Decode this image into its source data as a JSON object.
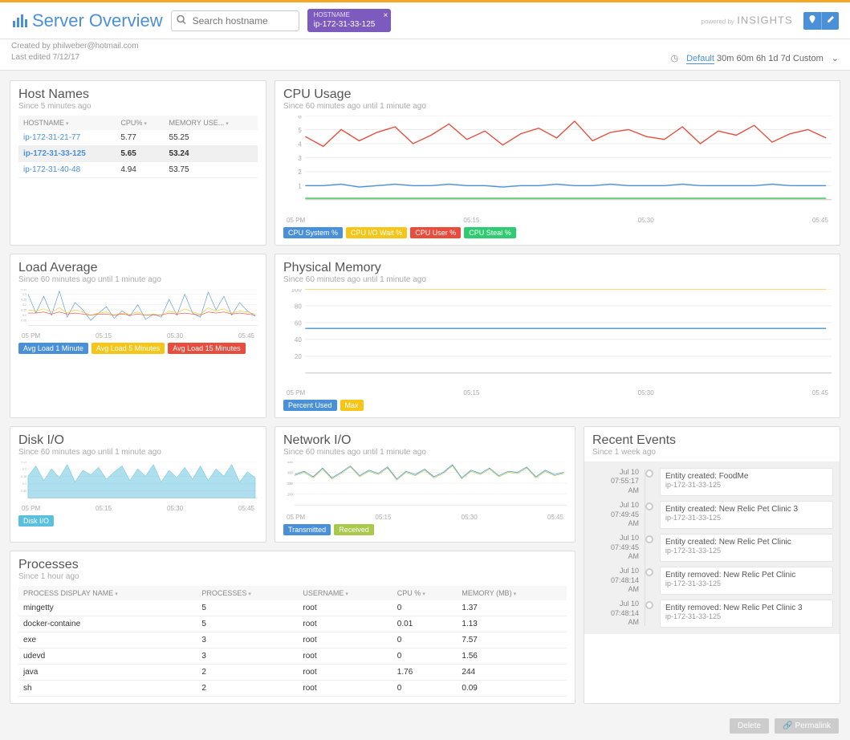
{
  "header": {
    "title": "Server Overview",
    "search_placeholder": "Search hostname",
    "chip_label": "HOSTNAME",
    "chip_value": "ip-172-31-33-125",
    "brand_powered": "powered by",
    "brand_name": "INSIGHTS"
  },
  "meta": {
    "created": "Created by philweber@hotmail.com",
    "edited": "Last edited 7/12/17"
  },
  "time_picker": {
    "options": [
      "Default",
      "30m",
      "60m",
      "6h",
      "1d",
      "7d",
      "Custom"
    ],
    "active": "Default"
  },
  "host_names": {
    "title": "Host Names",
    "subtitle": "Since 5 minutes ago",
    "columns": [
      "HOSTNAME",
      "CPU%",
      "MEMORY USE..."
    ],
    "rows": [
      {
        "host": "ip-172-31-21-77",
        "cpu": "5.77",
        "mem": "55.25",
        "selected": false
      },
      {
        "host": "ip-172-31-33-125",
        "cpu": "5.65",
        "mem": "53.24",
        "selected": true
      },
      {
        "host": "ip-172-31-40-48",
        "cpu": "4.94",
        "mem": "53.75",
        "selected": false
      }
    ]
  },
  "chart_data": [
    {
      "id": "cpu_usage",
      "title": "CPU Usage",
      "subtitle": "Since 60 minutes ago until 1 minute ago",
      "type": "line",
      "xticks": [
        "05 PM",
        "05:15",
        "05:30",
        "05:45"
      ],
      "ylim": [
        0,
        6
      ],
      "yticks": [
        1,
        2,
        3,
        4,
        5,
        6
      ],
      "series": [
        {
          "name": "CPU System %",
          "color": "#4a90d9",
          "values": [
            1.0,
            1.0,
            1.1,
            0.9,
            1.0,
            1.1,
            1.0,
            1.0,
            1.1,
            1.0,
            1.0,
            0.9,
            1.0,
            1.0,
            1.1,
            1.0,
            1.0,
            1.1,
            1.0,
            1.0,
            1.0,
            1.1,
            1.0,
            1.0,
            1.0,
            1.0,
            1.1,
            1.0,
            1.0,
            1.0
          ]
        },
        {
          "name": "CPU I/O Wait %",
          "color": "#f5c518",
          "values": [
            0.1,
            0.1,
            0.1,
            0.1,
            0.1,
            0.1,
            0.1,
            0.1,
            0.1,
            0.1,
            0.1,
            0.1,
            0.1,
            0.1,
            0.1,
            0.1,
            0.1,
            0.1,
            0.1,
            0.1,
            0.1,
            0.1,
            0.1,
            0.1,
            0.1,
            0.1,
            0.1,
            0.1,
            0.1,
            0.1
          ]
        },
        {
          "name": "CPU User %",
          "color": "#e74c3c",
          "values": [
            4.5,
            3.8,
            5.0,
            4.2,
            4.8,
            5.2,
            4.0,
            4.6,
            5.4,
            4.3,
            4.9,
            3.9,
            4.7,
            5.1,
            4.4,
            5.6,
            4.2,
            4.8,
            5.0,
            4.5,
            4.3,
            5.2,
            4.0,
            4.9,
            4.6,
            5.3,
            4.1,
            4.7,
            5.0,
            4.4
          ]
        },
        {
          "name": "CPU Steal %",
          "color": "#2ecc71",
          "values": [
            0.1,
            0.1,
            0.1,
            0.1,
            0.1,
            0.1,
            0.1,
            0.1,
            0.1,
            0.1,
            0.1,
            0.1,
            0.1,
            0.1,
            0.1,
            0.1,
            0.1,
            0.1,
            0.1,
            0.1,
            0.1,
            0.1,
            0.1,
            0.1,
            0.1,
            0.1,
            0.1,
            0.1,
            0.1,
            0.1
          ]
        }
      ]
    },
    {
      "id": "load_avg",
      "title": "Load Average",
      "subtitle": "Since 60 minutes ago until 1 minute ago",
      "type": "line",
      "xticks": [
        "05 PM",
        "05:15",
        "05:30",
        "05:45"
      ],
      "ylim": [
        0,
        0.35
      ],
      "yticks": [
        0.05,
        0.1,
        0.15,
        0.2,
        0.25,
        0.3,
        0.35
      ],
      "series": [
        {
          "name": "Avg Load 1 Minute",
          "color": "#4a90d9",
          "values": [
            0.3,
            0.12,
            0.28,
            0.1,
            0.33,
            0.08,
            0.22,
            0.15,
            0.05,
            0.12,
            0.18,
            0.07,
            0.14,
            0.09,
            0.2,
            0.06,
            0.11,
            0.08,
            0.25,
            0.1,
            0.3,
            0.12,
            0.08,
            0.32,
            0.15,
            0.28,
            0.1,
            0.22,
            0.14,
            0.09
          ]
        },
        {
          "name": "Avg Load 5 Minutes",
          "color": "#f5c518",
          "values": [
            0.15,
            0.14,
            0.16,
            0.13,
            0.17,
            0.12,
            0.15,
            0.13,
            0.1,
            0.12,
            0.13,
            0.1,
            0.12,
            0.11,
            0.13,
            0.1,
            0.11,
            0.1,
            0.14,
            0.12,
            0.16,
            0.13,
            0.11,
            0.17,
            0.14,
            0.16,
            0.12,
            0.14,
            0.13,
            0.11
          ]
        },
        {
          "name": "Avg Load 15 Minutes",
          "color": "#e74c3c",
          "values": [
            0.12,
            0.12,
            0.13,
            0.11,
            0.13,
            0.11,
            0.12,
            0.11,
            0.1,
            0.11,
            0.11,
            0.1,
            0.11,
            0.1,
            0.11,
            0.1,
            0.1,
            0.1,
            0.12,
            0.11,
            0.12,
            0.11,
            0.1,
            0.13,
            0.12,
            0.13,
            0.11,
            0.12,
            0.11,
            0.1
          ]
        }
      ]
    },
    {
      "id": "phys_mem",
      "title": "Physical Memory",
      "subtitle": "Since 60 minutes ago until 1 minute ago",
      "type": "line",
      "xticks": [
        "05 PM",
        "05:15",
        "05:30",
        "05:45"
      ],
      "ylim": [
        0,
        100
      ],
      "yticks": [
        20,
        40,
        60,
        80,
        100
      ],
      "series": [
        {
          "name": "Percent Used",
          "color": "#4a90d9",
          "values": [
            53,
            53,
            53,
            53,
            53,
            53,
            53,
            53,
            53,
            53,
            53,
            53,
            53,
            53,
            53,
            53,
            53,
            53,
            53,
            53,
            53,
            53,
            53,
            53,
            53,
            53,
            53,
            53,
            53,
            53
          ]
        },
        {
          "name": "Max",
          "color": "#f5c518",
          "values": [
            100,
            100,
            100,
            100,
            100,
            100,
            100,
            100,
            100,
            100,
            100,
            100,
            100,
            100,
            100,
            100,
            100,
            100,
            100,
            100,
            100,
            100,
            100,
            100,
            100,
            100,
            100,
            100,
            100,
            100
          ]
        }
      ]
    },
    {
      "id": "disk_io",
      "title": "Disk I/O",
      "subtitle": "Since 60 minutes ago until 1 minute ago",
      "type": "area",
      "xticks": [
        "05 PM",
        "05:15",
        "05:30",
        "05:45"
      ],
      "ylim": [
        0,
        0.25
      ],
      "yticks": [
        0.05,
        0.1,
        0.15,
        0.2,
        0.25
      ],
      "series": [
        {
          "name": "Disk I/O",
          "color": "#5bc0de",
          "values": [
            0.15,
            0.22,
            0.12,
            0.2,
            0.14,
            0.23,
            0.11,
            0.19,
            0.16,
            0.21,
            0.13,
            0.18,
            0.22,
            0.12,
            0.2,
            0.15,
            0.23,
            0.11,
            0.19,
            0.14,
            0.21,
            0.13,
            0.22,
            0.12,
            0.2,
            0.15,
            0.23,
            0.11,
            0.18,
            0.14
          ]
        }
      ]
    },
    {
      "id": "net_io",
      "title": "Network I/O",
      "subtitle": "Since 60 minutes ago until 1 minute ago",
      "type": "line",
      "xticks": [
        "05 PM",
        "05:15",
        "05:30",
        "05:45"
      ],
      "ylim": [
        0,
        400
      ],
      "yticks": [
        100,
        200,
        300,
        400
      ],
      "series": [
        {
          "name": "Transmitted",
          "color": "#4a90d9",
          "values": [
            280,
            310,
            260,
            340,
            250,
            300,
            360,
            270,
            320,
            290,
            350,
            240,
            310,
            280,
            330,
            260,
            300,
            370,
            250,
            320,
            290,
            340,
            270,
            310,
            300,
            350,
            260,
            320,
            280,
            300
          ]
        },
        {
          "name": "Received",
          "color": "#a8c94a",
          "values": [
            270,
            300,
            250,
            330,
            240,
            290,
            350,
            260,
            310,
            280,
            340,
            230,
            300,
            270,
            320,
            250,
            290,
            360,
            240,
            310,
            280,
            330,
            260,
            300,
            290,
            340,
            250,
            310,
            270,
            290
          ]
        }
      ]
    }
  ],
  "processes": {
    "title": "Processes",
    "subtitle": "Since 1 hour ago",
    "columns": [
      "PROCESS DISPLAY NAME",
      "PROCESSES",
      "USERNAME",
      "CPU %",
      "MEMORY (MB)"
    ],
    "rows": [
      {
        "name": "mingetty",
        "proc": "5",
        "user": "root",
        "cpu": "0",
        "mem": "1.37"
      },
      {
        "name": "docker-containe",
        "proc": "5",
        "user": "root",
        "cpu": "0.01",
        "mem": "1.13"
      },
      {
        "name": "exe",
        "proc": "3",
        "user": "root",
        "cpu": "0",
        "mem": "7.57"
      },
      {
        "name": "udevd",
        "proc": "3",
        "user": "root",
        "cpu": "0",
        "mem": "1.56"
      },
      {
        "name": "java",
        "proc": "2",
        "user": "root",
        "cpu": "1.76",
        "mem": "244"
      },
      {
        "name": "sh",
        "proc": "2",
        "user": "root",
        "cpu": "0",
        "mem": "0.09"
      }
    ]
  },
  "events": {
    "title": "Recent Events",
    "subtitle": "Since 1 week ago",
    "items": [
      {
        "date": "Jul 10",
        "time": "07:55:17",
        "ampm": "AM",
        "title": "Entity created: FoodMe",
        "host": "ip-172-31-33-125"
      },
      {
        "date": "Jul 10",
        "time": "07:49:45",
        "ampm": "AM",
        "title": "Entity created: New Relic Pet Clinic 3",
        "host": "ip-172-31-33-125"
      },
      {
        "date": "Jul 10",
        "time": "07:49:45",
        "ampm": "AM",
        "title": "Entity created: New Relic Pet Clinic",
        "host": "ip-172-31-33-125"
      },
      {
        "date": "Jul 10",
        "time": "07:48:14",
        "ampm": "AM",
        "title": "Entity removed: New Relic Pet Clinic",
        "host": "ip-172-31-33-125"
      },
      {
        "date": "Jul 10",
        "time": "07:48:14",
        "ampm": "AM",
        "title": "Entity removed: New Relic Pet Clinic 3",
        "host": "ip-172-31-33-125"
      }
    ]
  },
  "footer": {
    "delete": "Delete",
    "permalink": "Permalink"
  }
}
